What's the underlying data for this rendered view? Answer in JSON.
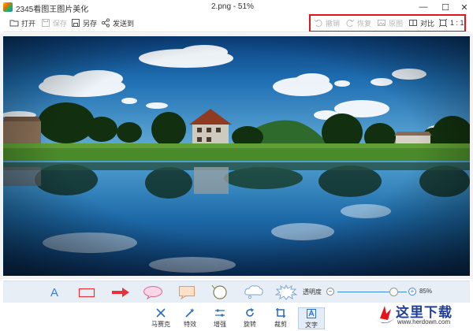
{
  "window": {
    "app_title": "2345看图王图片美化",
    "file_title": "2.png - 51%",
    "controls": [
      "—",
      "☐",
      "✕"
    ]
  },
  "toolbar": {
    "open_label": "打开",
    "save_label": "保存",
    "saveas_label": "另存",
    "send_label": "发送到",
    "undo_label": "撤销",
    "redo_label": "恢复",
    "original_label": "原图",
    "compare_label": "对比",
    "ratio_label": "1 : 1"
  },
  "annotation": {
    "tools": [
      "text-tool",
      "rectangle-tool",
      "arrow-tool",
      "ellipse-bubble-tool",
      "rect-bubble-tool",
      "round-bubble-tool",
      "cloud-bubble-tool",
      "burst-bubble-tool"
    ],
    "text_glyph": "A",
    "opacity_label": "透明度",
    "minus": "−",
    "plus": "+",
    "opacity_value": "85%",
    "opacity_fraction": 0.85
  },
  "bottom_tools": {
    "mosaic": "马赛克",
    "effects": "特效",
    "adjust": "增强",
    "rotate": "旋转",
    "crop": "裁剪",
    "text": "文字"
  },
  "watermark": {
    "text": "这里下载",
    "url": "www.herdown.com"
  },
  "colors": {
    "highlight": "#e4141b",
    "accent": "#3b8de0",
    "arrow": "#e8323a",
    "brand": "#1f3f9a"
  }
}
